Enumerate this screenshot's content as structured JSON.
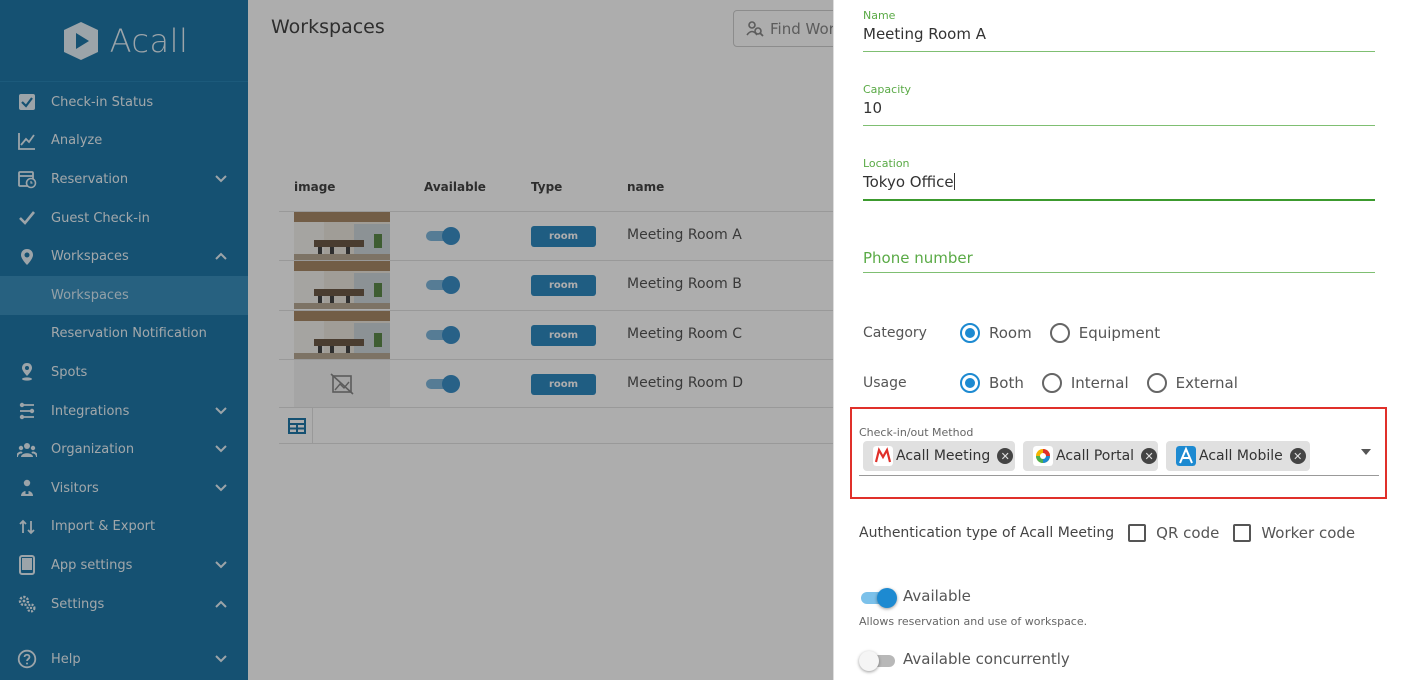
{
  "app": {
    "brand": "Acall"
  },
  "sidebar": {
    "items": [
      {
        "label": "Check-in Status",
        "icon": "checkbox-icon",
        "chevron": ""
      },
      {
        "label": "Analyze",
        "icon": "chart-line-icon",
        "chevron": ""
      },
      {
        "label": "Reservation",
        "icon": "calendar-clock-icon",
        "chevron": "down"
      },
      {
        "label": "Guest Check-in",
        "icon": "checkmark-icon",
        "chevron": ""
      },
      {
        "label": "Workspaces",
        "icon": "map-pin-icon",
        "chevron": "up"
      },
      {
        "label": "Workspaces",
        "icon": "",
        "chevron": "",
        "sub": true,
        "active": true
      },
      {
        "label": "Reservation Notification",
        "icon": "",
        "chevron": "",
        "sub": true
      },
      {
        "label": "Spots",
        "icon": "person-pin-icon",
        "chevron": ""
      },
      {
        "label": "Integrations",
        "icon": "integrations-icon",
        "chevron": "down"
      },
      {
        "label": "Organization",
        "icon": "people-icon",
        "chevron": "down"
      },
      {
        "label": "Visitors",
        "icon": "visitor-icon",
        "chevron": "down"
      },
      {
        "label": "Import & Export",
        "icon": "import-export-icon",
        "chevron": ""
      },
      {
        "label": "App settings",
        "icon": "tablet-icon",
        "chevron": "down"
      },
      {
        "label": "Settings",
        "icon": "gears-icon",
        "chevron": "up"
      },
      {
        "label": "Help",
        "icon": "help-icon",
        "chevron": "down"
      }
    ]
  },
  "main": {
    "title": "Workspaces",
    "search_placeholder": "Find Wor",
    "columns": {
      "image": "image",
      "available": "Available",
      "type": "Type",
      "name": "name"
    },
    "rows": [
      {
        "name": "Meeting Room A",
        "type": "room",
        "available": true,
        "has_image": true
      },
      {
        "name": "Meeting Room B",
        "type": "room",
        "available": true,
        "has_image": true
      },
      {
        "name": "Meeting Room C",
        "type": "room",
        "available": true,
        "has_image": true
      },
      {
        "name": "Meeting Room D",
        "type": "room",
        "available": true,
        "has_image": false
      }
    ]
  },
  "drawer": {
    "name_label": "Name",
    "name_value": "Meeting Room A",
    "capacity_label": "Capacity",
    "capacity_value": "10",
    "location_label": "Location",
    "location_value": "Tokyo Office",
    "phone_placeholder": "Phone number",
    "category_label": "Category",
    "category_options": [
      {
        "label": "Room",
        "selected": true
      },
      {
        "label": "Equipment",
        "selected": false
      }
    ],
    "usage_label": "Usage",
    "usage_options": [
      {
        "label": "Both",
        "selected": true
      },
      {
        "label": "Internal",
        "selected": false
      },
      {
        "label": "External",
        "selected": false
      }
    ],
    "method_label": "Check-in/out Method",
    "methods": [
      {
        "label": "Acall Meeting",
        "icon": "acall-meeting-icon"
      },
      {
        "label": "Acall Portal",
        "icon": "acall-portal-icon"
      },
      {
        "label": "Acall Mobile",
        "icon": "acall-mobile-icon"
      }
    ],
    "auth_label": "Authentication type of Acall Meeting",
    "auth_options": [
      {
        "label": "QR code",
        "checked": false
      },
      {
        "label": "Worker code",
        "checked": false
      }
    ],
    "available_label": "Available",
    "available_on": true,
    "available_help": "Allows reservation and use of workspace.",
    "concurrent_label": "Available concurrently",
    "concurrent_on": false
  },
  "colors": {
    "sidebar": "#1f78a8",
    "accent": "#1d8ad1",
    "field_green": "#5aaa46",
    "highlight": "#e0302a"
  }
}
